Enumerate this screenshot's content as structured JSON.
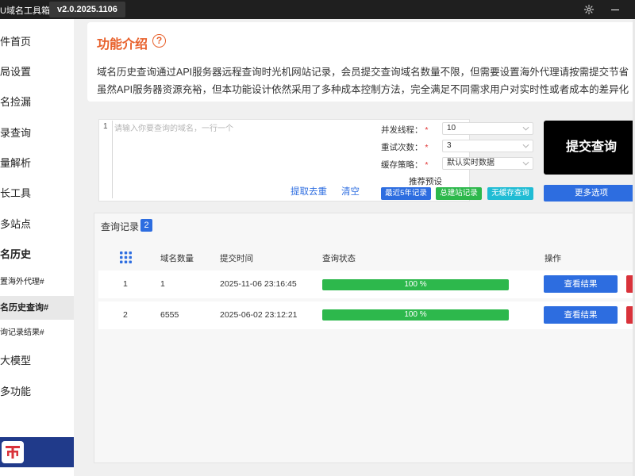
{
  "titlebar": {
    "app_title": "U域名工具箱",
    "version": "v2.0.2025.1106",
    "settings_icon": "gear-icon",
    "minimize_icon": "minimize-icon"
  },
  "sidebar": {
    "items": [
      {
        "label": "件首页",
        "type": "main"
      },
      {
        "label": "局设置",
        "type": "main"
      },
      {
        "label": "名捡漏",
        "type": "main"
      },
      {
        "label": "录查询",
        "type": "main"
      },
      {
        "label": "量解析",
        "type": "main"
      },
      {
        "label": "长工具",
        "type": "main"
      },
      {
        "label": "多站点",
        "type": "main"
      },
      {
        "label": "名历史",
        "type": "main-bold"
      },
      {
        "label": "置海外代理#",
        "type": "sub"
      },
      {
        "label": "名历史查询#",
        "type": "sub-active"
      },
      {
        "label": "询记录结果#",
        "type": "sub"
      },
      {
        "label": "大模型",
        "type": "main"
      },
      {
        "label": "多功能",
        "type": "main"
      }
    ],
    "footer_logo_icon": "brand-logo-icon",
    "footer_color": "#203a8a"
  },
  "intro": {
    "title": "功能介绍",
    "help_icon": "question-circle-icon",
    "line1": "域名历史查询通过API服务器远程查询时光机网站记录，会员提交查询域名数量不限，但需要设置海外代理请按需提交节省",
    "line2": "虽然API服务器资源充裕，但本功能设计依然采用了多种成本控制方法，完全满足不同需求用户对实时性或者成本的差异化"
  },
  "query": {
    "line_number": "1",
    "placeholder": "请输入你要查询的域名，一行一个",
    "extract_dedupe": "提取去重",
    "clear": "清空",
    "params": [
      {
        "label": "并发线程：",
        "required": "*",
        "value": "10"
      },
      {
        "label": "重试次数：",
        "required": "*",
        "value": "3"
      },
      {
        "label": "缓存策略：",
        "required": "*",
        "value": "默认实时数据"
      }
    ],
    "preset_title": "推荐预设",
    "presets": [
      {
        "label": "最近5年记录",
        "color": "#2d6de0"
      },
      {
        "label": "总建站记录",
        "color": "#2db84c"
      },
      {
        "label": "无缓存查询",
        "color": "#20bcd4"
      }
    ],
    "submit": "提交查询",
    "more_options": "更多选项"
  },
  "records": {
    "title": "查询记录",
    "count": "2",
    "columns": [
      "域名数量",
      "提交时间",
      "查询状态",
      "操作"
    ],
    "columns_icon": "grid-icon",
    "rows": [
      {
        "index": "1",
        "count": "1",
        "time": "2025-11-06 23:16:45",
        "progress": 100,
        "progress_label": "100 %",
        "action": "查看结果"
      },
      {
        "index": "2",
        "count": "6555",
        "time": "2025-06-02 23:12:21",
        "progress": 100,
        "progress_label": "100 %",
        "action": "查看结果"
      }
    ]
  },
  "colors": {
    "accent": "#e8612c",
    "primary": "#2d6de0",
    "success": "#2db84c",
    "danger": "#d9323a"
  }
}
